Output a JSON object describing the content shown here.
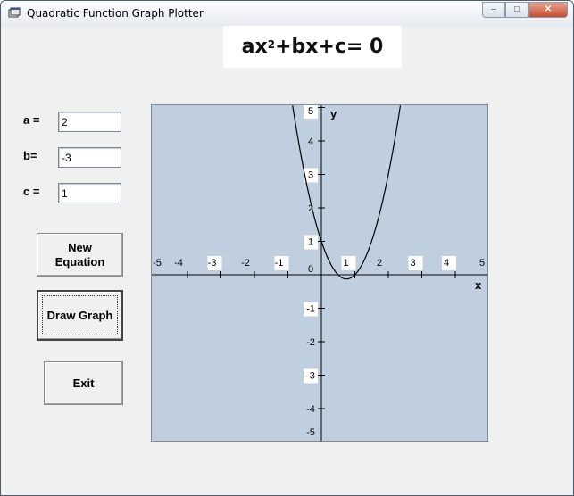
{
  "window": {
    "title": "Quadratic Function Graph Plotter",
    "controls": {
      "minimize": "–",
      "maximize": "□",
      "close": "✕"
    }
  },
  "formula": {
    "a_text": "ax",
    "exponent": "2",
    "rest": "+bx+c",
    "equals": " = 0"
  },
  "inputs": {
    "a": {
      "label": "a =",
      "value": "2"
    },
    "b": {
      "label": "b=",
      "value": "-3"
    },
    "c": {
      "label": "c =",
      "value": "1"
    }
  },
  "buttons": {
    "new_equation": "New\nEquation",
    "draw_graph": "Draw Graph",
    "exit": "Exit"
  },
  "chart_data": {
    "type": "line",
    "function": "y = 2x^2 - 3x + 1",
    "coefficients": {
      "a": 2,
      "b": -3,
      "c": 1
    },
    "xlabel": "x",
    "ylabel": "y",
    "xlim": [
      -5,
      5
    ],
    "ylim": [
      -5,
      5
    ],
    "x_ticks": [
      "-5",
      "-4",
      "-3",
      "-2",
      "-1",
      "0",
      "1",
      "2",
      "3",
      "4",
      "5"
    ],
    "y_ticks": [
      "5",
      "4",
      "3",
      "2",
      "1",
      "-1",
      "-2",
      "-3",
      "-4",
      "-5"
    ],
    "grid": false,
    "background": "#bfcfdf",
    "line_color": "#000000"
  }
}
